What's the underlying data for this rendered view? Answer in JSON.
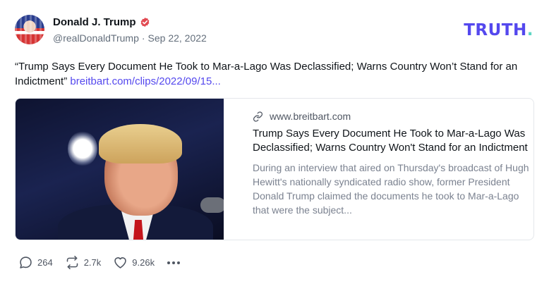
{
  "author": {
    "display_name": "Donald J. Trump",
    "handle": "@realDonaldTrump",
    "separator": "·",
    "date": "Sep 22, 2022",
    "verified_icon": "verified-badge-icon"
  },
  "brand": {
    "wordmark": "TRUTH",
    "wordmark_dot": ".",
    "color": "#5448ee",
    "dot_color": "#5fd6c4"
  },
  "post": {
    "text": "“Trump Says Every Document He Took to Mar-a-Lago Was Declassified; Warns Country Won’t Stand for an Indictment”",
    "link_text": "breitbart.com/clips/2022/09/15..."
  },
  "card": {
    "domain": "www.breitbart.com",
    "title": "Trump Says Every Document He Took to Mar-a-Lago Was Declassified; Warns Country Won't Stand for an Indictment",
    "description": "During an interview that aired on Thursday's broadcast of Hugh Hewitt's nationally syndicated radio show, former President Donald Trump claimed the documents he took to Mar-a-Lago that were the subject..."
  },
  "actions": {
    "replies": "264",
    "retruths": "2.7k",
    "likes": "9.26k"
  },
  "colors": {
    "accent": "#5448ee",
    "verified": "#e24a52",
    "muted_text": "#636e7b"
  }
}
